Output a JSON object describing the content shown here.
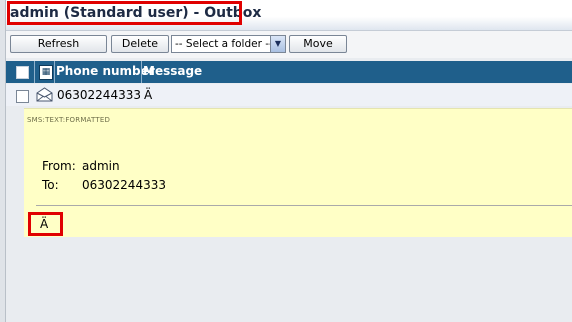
{
  "window": {
    "title": "admin (Standard user) - Outbox"
  },
  "toolbar": {
    "refresh_label": "Refresh",
    "delete_label": "Delete",
    "folder_select_value": "-- Select a folder --",
    "move_label": "Move"
  },
  "table": {
    "columns": [
      "Phone number",
      "Message"
    ],
    "rows": [
      {
        "phone": "06302244333",
        "message": "Ä"
      }
    ]
  },
  "detail": {
    "format_tag": "SMS:TEXT:FORMATTED",
    "from_label": "From:",
    "from_value": "admin",
    "to_label": "To:",
    "to_value": "06302244333",
    "body": "Ä"
  },
  "colors": {
    "header_bg": "#1f5f8b",
    "detail_bg": "#ffffc6",
    "highlight": "#e00000"
  },
  "icons": [
    "envelope-icon",
    "message-type-icon",
    "select-arrow-icon"
  ]
}
